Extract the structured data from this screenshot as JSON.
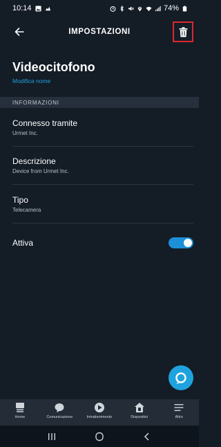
{
  "status_bar": {
    "time": "10:14",
    "battery": "74%"
  },
  "header": {
    "title": "IMPOSTAZIONI",
    "back_icon": "arrow-left-icon",
    "delete_icon": "trash-icon",
    "highlight_color": "#e0262f"
  },
  "device": {
    "name": "Videocitofono",
    "rename_label": "Modifica nome"
  },
  "section": {
    "title": "INFORMAZIONI"
  },
  "info_rows": [
    {
      "title": "Connesso tramite",
      "subtitle": "Urmet Inc."
    },
    {
      "title": "Descrizione",
      "subtitle": "Device from Urmet Inc."
    },
    {
      "title": "Tipo",
      "subtitle": "Telecamera"
    }
  ],
  "active_toggle": {
    "label": "Attiva",
    "enabled": true,
    "color": "#1d8fd8"
  },
  "bottom_nav": [
    {
      "label": "Home",
      "icon": "home-icon"
    },
    {
      "label": "Comunicazione",
      "icon": "chat-icon"
    },
    {
      "label": "Intrattenimento",
      "icon": "play-icon"
    },
    {
      "label": "Dispositivi",
      "icon": "devices-icon"
    },
    {
      "label": "Altro",
      "icon": "menu-icon"
    }
  ],
  "colors": {
    "background": "#141c26",
    "accent": "#1fa3de"
  }
}
